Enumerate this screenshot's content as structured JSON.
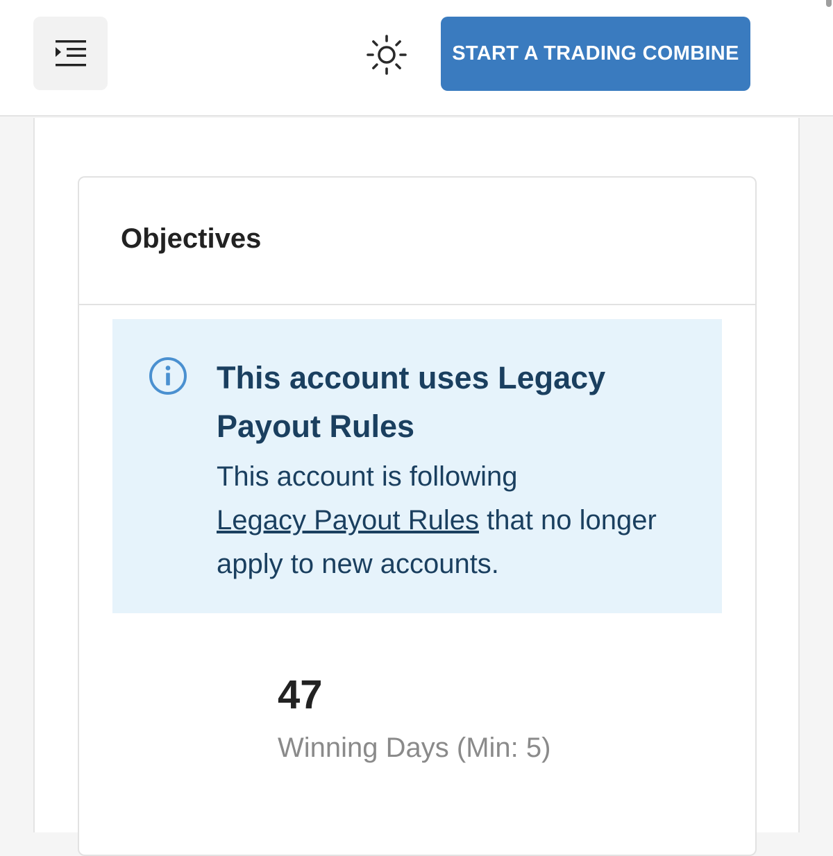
{
  "header": {
    "menu_icon": "menu-indent-icon",
    "theme_icon": "sun-icon",
    "cta_label": "START A TRADING COMBINE"
  },
  "objectives": {
    "title": "Objectives",
    "alert": {
      "icon": "info-icon",
      "accent_color": "#4a90d0",
      "title": "This account uses Legacy Payout Rules",
      "body_prefix": "This account is following",
      "link_text": "Legacy Payout Rules",
      "body_suffix": "that no longer apply to new accounts."
    },
    "stat": {
      "value": "47",
      "label": "Winning Days (Min: 5)"
    }
  },
  "colors": {
    "primary": "#3a7bbf",
    "alert_background": "#e6f3fb",
    "alert_text": "#1a3f5f"
  }
}
